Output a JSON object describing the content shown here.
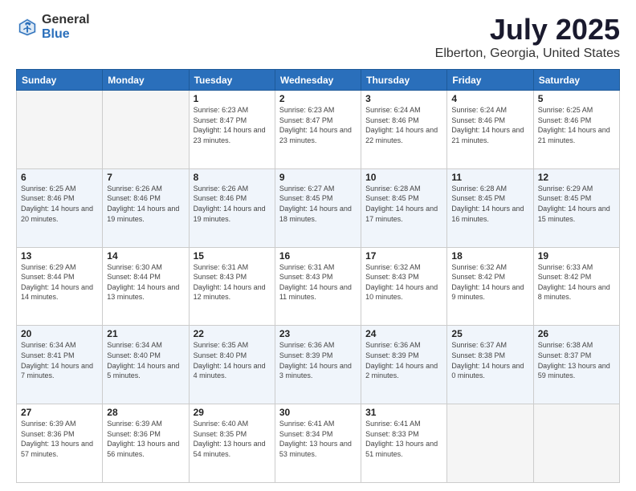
{
  "header": {
    "logo_general": "General",
    "logo_blue": "Blue",
    "title": "July 2025",
    "subtitle": "Elberton, Georgia, United States"
  },
  "days_of_week": [
    "Sunday",
    "Monday",
    "Tuesday",
    "Wednesday",
    "Thursday",
    "Friday",
    "Saturday"
  ],
  "weeks": [
    [
      {
        "day": "",
        "info": ""
      },
      {
        "day": "",
        "info": ""
      },
      {
        "day": "1",
        "info": "Sunrise: 6:23 AM\nSunset: 8:47 PM\nDaylight: 14 hours and 23 minutes."
      },
      {
        "day": "2",
        "info": "Sunrise: 6:23 AM\nSunset: 8:47 PM\nDaylight: 14 hours and 23 minutes."
      },
      {
        "day": "3",
        "info": "Sunrise: 6:24 AM\nSunset: 8:46 PM\nDaylight: 14 hours and 22 minutes."
      },
      {
        "day": "4",
        "info": "Sunrise: 6:24 AM\nSunset: 8:46 PM\nDaylight: 14 hours and 21 minutes."
      },
      {
        "day": "5",
        "info": "Sunrise: 6:25 AM\nSunset: 8:46 PM\nDaylight: 14 hours and 21 minutes."
      }
    ],
    [
      {
        "day": "6",
        "info": "Sunrise: 6:25 AM\nSunset: 8:46 PM\nDaylight: 14 hours and 20 minutes."
      },
      {
        "day": "7",
        "info": "Sunrise: 6:26 AM\nSunset: 8:46 PM\nDaylight: 14 hours and 19 minutes."
      },
      {
        "day": "8",
        "info": "Sunrise: 6:26 AM\nSunset: 8:46 PM\nDaylight: 14 hours and 19 minutes."
      },
      {
        "day": "9",
        "info": "Sunrise: 6:27 AM\nSunset: 8:45 PM\nDaylight: 14 hours and 18 minutes."
      },
      {
        "day": "10",
        "info": "Sunrise: 6:28 AM\nSunset: 8:45 PM\nDaylight: 14 hours and 17 minutes."
      },
      {
        "day": "11",
        "info": "Sunrise: 6:28 AM\nSunset: 8:45 PM\nDaylight: 14 hours and 16 minutes."
      },
      {
        "day": "12",
        "info": "Sunrise: 6:29 AM\nSunset: 8:45 PM\nDaylight: 14 hours and 15 minutes."
      }
    ],
    [
      {
        "day": "13",
        "info": "Sunrise: 6:29 AM\nSunset: 8:44 PM\nDaylight: 14 hours and 14 minutes."
      },
      {
        "day": "14",
        "info": "Sunrise: 6:30 AM\nSunset: 8:44 PM\nDaylight: 14 hours and 13 minutes."
      },
      {
        "day": "15",
        "info": "Sunrise: 6:31 AM\nSunset: 8:43 PM\nDaylight: 14 hours and 12 minutes."
      },
      {
        "day": "16",
        "info": "Sunrise: 6:31 AM\nSunset: 8:43 PM\nDaylight: 14 hours and 11 minutes."
      },
      {
        "day": "17",
        "info": "Sunrise: 6:32 AM\nSunset: 8:43 PM\nDaylight: 14 hours and 10 minutes."
      },
      {
        "day": "18",
        "info": "Sunrise: 6:32 AM\nSunset: 8:42 PM\nDaylight: 14 hours and 9 minutes."
      },
      {
        "day": "19",
        "info": "Sunrise: 6:33 AM\nSunset: 8:42 PM\nDaylight: 14 hours and 8 minutes."
      }
    ],
    [
      {
        "day": "20",
        "info": "Sunrise: 6:34 AM\nSunset: 8:41 PM\nDaylight: 14 hours and 7 minutes."
      },
      {
        "day": "21",
        "info": "Sunrise: 6:34 AM\nSunset: 8:40 PM\nDaylight: 14 hours and 5 minutes."
      },
      {
        "day": "22",
        "info": "Sunrise: 6:35 AM\nSunset: 8:40 PM\nDaylight: 14 hours and 4 minutes."
      },
      {
        "day": "23",
        "info": "Sunrise: 6:36 AM\nSunset: 8:39 PM\nDaylight: 14 hours and 3 minutes."
      },
      {
        "day": "24",
        "info": "Sunrise: 6:36 AM\nSunset: 8:39 PM\nDaylight: 14 hours and 2 minutes."
      },
      {
        "day": "25",
        "info": "Sunrise: 6:37 AM\nSunset: 8:38 PM\nDaylight: 14 hours and 0 minutes."
      },
      {
        "day": "26",
        "info": "Sunrise: 6:38 AM\nSunset: 8:37 PM\nDaylight: 13 hours and 59 minutes."
      }
    ],
    [
      {
        "day": "27",
        "info": "Sunrise: 6:39 AM\nSunset: 8:36 PM\nDaylight: 13 hours and 57 minutes."
      },
      {
        "day": "28",
        "info": "Sunrise: 6:39 AM\nSunset: 8:36 PM\nDaylight: 13 hours and 56 minutes."
      },
      {
        "day": "29",
        "info": "Sunrise: 6:40 AM\nSunset: 8:35 PM\nDaylight: 13 hours and 54 minutes."
      },
      {
        "day": "30",
        "info": "Sunrise: 6:41 AM\nSunset: 8:34 PM\nDaylight: 13 hours and 53 minutes."
      },
      {
        "day": "31",
        "info": "Sunrise: 6:41 AM\nSunset: 8:33 PM\nDaylight: 13 hours and 51 minutes."
      },
      {
        "day": "",
        "info": ""
      },
      {
        "day": "",
        "info": ""
      }
    ]
  ]
}
